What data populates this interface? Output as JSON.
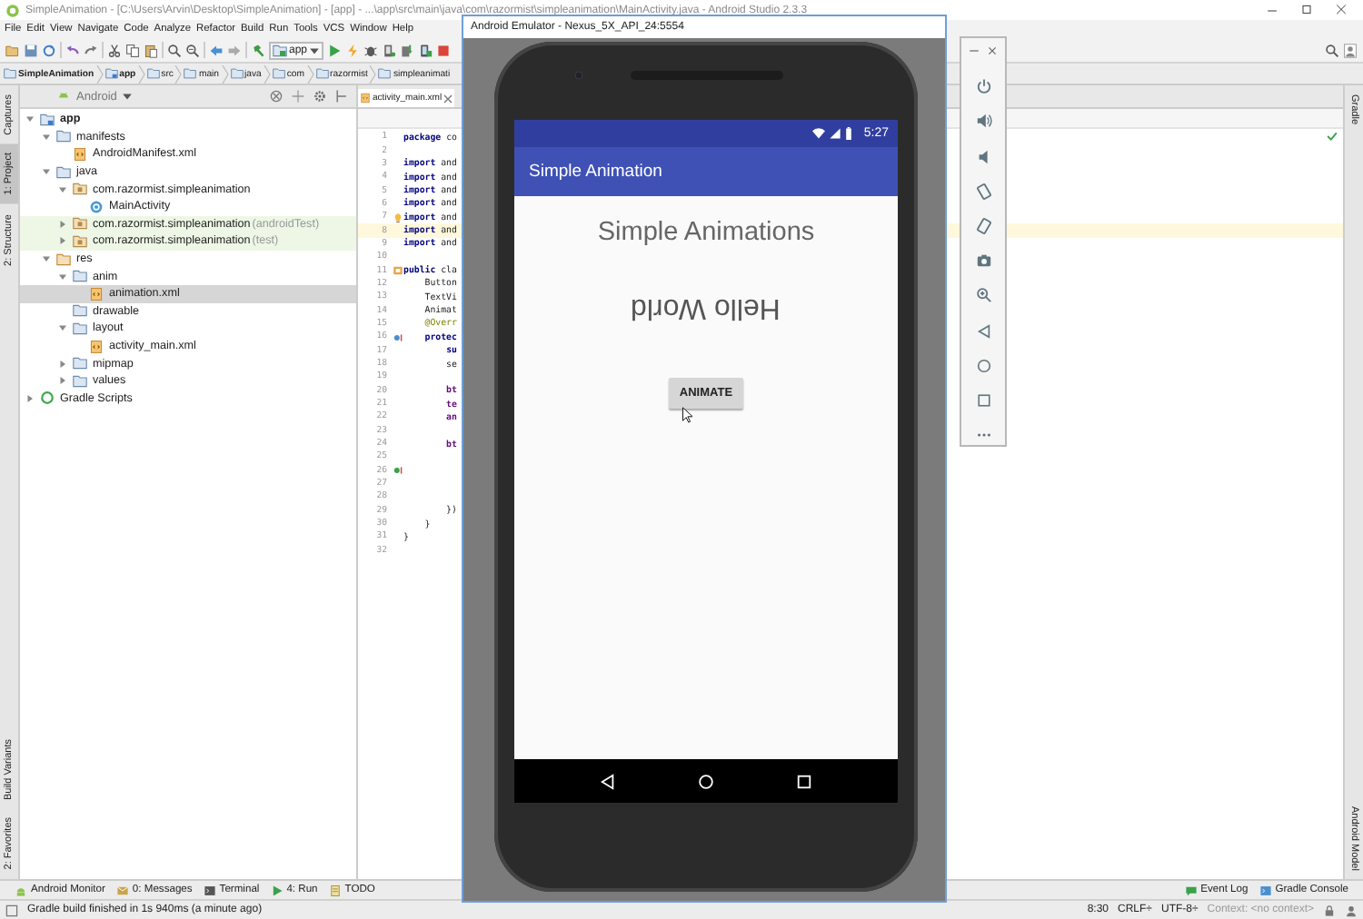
{
  "window": {
    "title": "SimpleAnimation - [C:\\Users\\Arvin\\Desktop\\SimpleAnimation] - [app] - ...\\app\\src\\main\\java\\com\\razormist\\simpleanimation\\MainActivity.java - Android Studio 2.3.3"
  },
  "menu": [
    "File",
    "Edit",
    "View",
    "Navigate",
    "Code",
    "Analyze",
    "Refactor",
    "Build",
    "Run",
    "Tools",
    "VCS",
    "Window",
    "Help"
  ],
  "toolbar": {
    "configuration": "app"
  },
  "breadcrumb": [
    "SimpleAnimation",
    "app",
    "src",
    "main",
    "java",
    "com",
    "razormist",
    "simpleanimati"
  ],
  "left_tabs_top": [
    {
      "label": "Captures",
      "selected": false
    },
    {
      "label": "1: Project",
      "selected": true
    },
    {
      "label": "2: Structure",
      "selected": false
    }
  ],
  "left_tabs_bottom": [
    {
      "label": "Build Variants",
      "selected": false
    },
    {
      "label": "2: Favorites",
      "selected": false
    }
  ],
  "project": {
    "view": "Android",
    "tree": [
      {
        "label": "app",
        "kind": "module",
        "expanded": true,
        "selected": false,
        "children": [
          {
            "label": "manifests",
            "kind": "folder",
            "expanded": true,
            "selected": false,
            "children": [
              {
                "label": "AndroidManifest.xml",
                "kind": "xml",
                "selected": false
              }
            ]
          },
          {
            "label": "java",
            "kind": "folder",
            "expanded": true,
            "selected": false,
            "children": [
              {
                "label": "com.razormist.simpleanimation",
                "kind": "package",
                "expanded": true,
                "selected": false,
                "test": false,
                "children": [
                  {
                    "label": "MainActivity",
                    "kind": "class",
                    "selected": false
                  }
                ]
              },
              {
                "label": "com.razormist.simpleanimation",
                "suffix": "(androidTest)",
                "kind": "package",
                "expanded": false,
                "selected": false,
                "test": true
              },
              {
                "label": "com.razormist.simpleanimation",
                "suffix": "(test)",
                "kind": "package",
                "expanded": false,
                "selected": false,
                "test": true
              }
            ]
          },
          {
            "label": "res",
            "kind": "res",
            "expanded": true,
            "selected": false,
            "children": [
              {
                "label": "anim",
                "kind": "folder",
                "expanded": true,
                "selected": false,
                "children": [
                  {
                    "label": "animation.xml",
                    "kind": "xml",
                    "selected": true
                  }
                ]
              },
              {
                "label": "drawable",
                "kind": "folder",
                "selected": false
              },
              {
                "label": "layout",
                "kind": "folder",
                "expanded": true,
                "selected": false,
                "children": [
                  {
                    "label": "activity_main.xml",
                    "kind": "xml",
                    "selected": false
                  }
                ]
              },
              {
                "label": "mipmap",
                "kind": "folder",
                "expanded": false,
                "selected": false
              },
              {
                "label": "values",
                "kind": "folder",
                "expanded": false,
                "selected": false
              }
            ]
          }
        ]
      },
      {
        "label": "Gradle Scripts",
        "kind": "gradle",
        "expanded": false,
        "selected": false
      }
    ]
  },
  "editor": {
    "tabs": [
      {
        "label": "activity_main.xml",
        "selected": true
      }
    ],
    "lines": [
      {
        "n": "1",
        "text": "**package** co",
        "current": false
      },
      {
        "n": "2",
        "current": false
      },
      {
        "n": "3",
        "text": "**import** and",
        "current": false
      },
      {
        "n": "4",
        "text": "**import** and",
        "current": false
      },
      {
        "n": "5",
        "text": "**import** and",
        "current": false
      },
      {
        "n": "6",
        "text": "**import** and",
        "current": false
      },
      {
        "n": "7",
        "text": "**import** and",
        "current": false
      },
      {
        "n": "8",
        "text": "**import** and",
        "current": true
      },
      {
        "n": "9",
        "text": "**import** and",
        "current": false
      },
      {
        "n": "10",
        "current": false
      },
      {
        "n": "11",
        "text": "**public** cla",
        "current": false
      },
      {
        "n": "12",
        "text": "    Button",
        "current": false
      },
      {
        "n": "13",
        "text": "    TextVi",
        "current": false
      },
      {
        "n": "14",
        "text": "    Animat",
        "current": false
      },
      {
        "n": "15",
        "text": "    @Overr",
        "kind": "annotation",
        "current": false
      },
      {
        "n": "16",
        "text": "    **protec**",
        "current": false
      },
      {
        "n": "17",
        "text": "        **su**",
        "current": false
      },
      {
        "n": "18",
        "text": "        se",
        "current": false
      },
      {
        "n": "19",
        "current": false
      },
      {
        "n": "20",
        "text": "        bt",
        "kind": "field",
        "current": false
      },
      {
        "n": "21",
        "text": "        te",
        "kind": "field",
        "current": false
      },
      {
        "n": "22",
        "text": "        an",
        "kind": "field",
        "current": false
      },
      {
        "n": "23",
        "current": false
      },
      {
        "n": "24",
        "text": "        bt",
        "kind": "field",
        "current": false
      },
      {
        "n": "25",
        "current": false
      },
      {
        "n": "26",
        "current": false
      },
      {
        "n": "27",
        "current": false
      },
      {
        "n": "28",
        "current": false
      },
      {
        "n": "29",
        "text": "        })",
        "current": false
      },
      {
        "n": "30",
        "text": "    }",
        "current": false
      },
      {
        "n": "31",
        "text": "}",
        "current": false
      },
      {
        "n": "32",
        "current": false
      }
    ]
  },
  "right_tabs_top": [
    "Gradle"
  ],
  "right_tabs_bottom": [
    "Android Model"
  ],
  "emulator": {
    "title": "Android Emulator - Nexus_5X_API_24:5554",
    "clock": "5:27",
    "app_title": "Simple Animation",
    "heading": "Simple Animations",
    "message": {
      "text": "Hello World",
      "flipped": true
    },
    "button": "ANIMATE"
  },
  "tool_tabs_left": [
    "Android Monitor",
    "0: Messages",
    "Terminal",
    "4: Run",
    "TODO"
  ],
  "tool_tabs_right": [
    "Event Log",
    "Gradle Console"
  ],
  "status_bar": {
    "message": "Gradle build finished in 1s 940ms (a minute ago)",
    "items": [
      "8:30",
      "CRLF÷",
      "UTF-8÷",
      "Context: <no context>"
    ]
  }
}
